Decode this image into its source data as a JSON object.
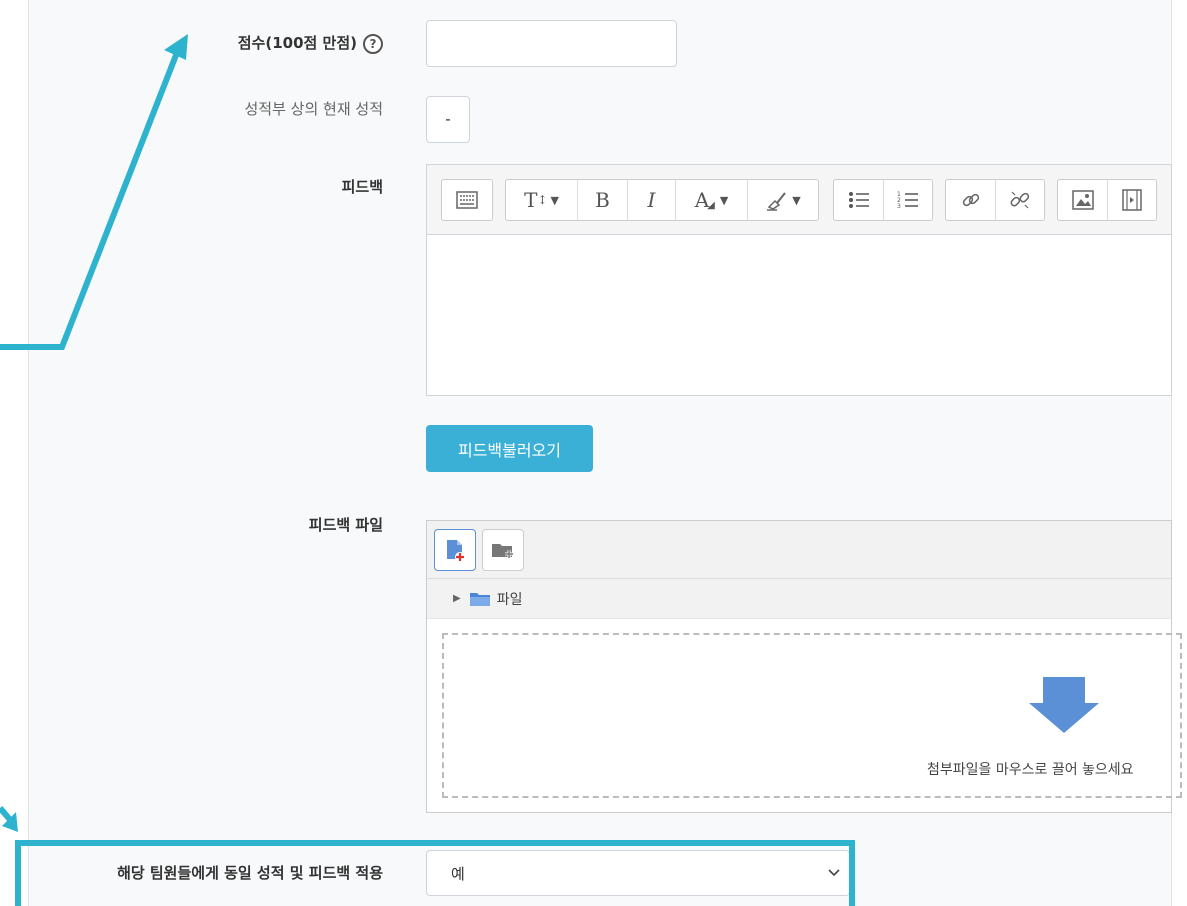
{
  "score": {
    "label": "점수(100점 만점)",
    "help_icon": "?",
    "input_value": ""
  },
  "current_grade": {
    "label": "성적부 상의 현재 성적",
    "value": "-"
  },
  "feedback": {
    "label": "피드백",
    "toolbar_icons": [
      "show-more-icon",
      "paragraph-style-icon",
      "bold-icon",
      "italic-icon",
      "font-color-icon",
      "highlight-icon",
      "unordered-list-icon",
      "ordered-list-icon",
      "link-icon",
      "unlink-icon",
      "image-icon",
      "media-icon"
    ],
    "bold_glyph": "B",
    "italic_glyph": "I",
    "style_glyph": "T",
    "font_color_glyph": "A"
  },
  "load_feedback_button": "피드백불러오기",
  "feedback_files": {
    "label": "피드백 파일",
    "folder_name": "파일",
    "drop_hint": "첨부파일을 마우스로 끌어 놓으세요"
  },
  "apply_to_team": {
    "label": "해당 팀원들에게 동일 성적 및 피드백 적용",
    "selected": "예"
  },
  "colors": {
    "accent": "#3ab0d6",
    "annotation": "#2eb3cf",
    "drop_arrow": "#5b8fd6"
  }
}
